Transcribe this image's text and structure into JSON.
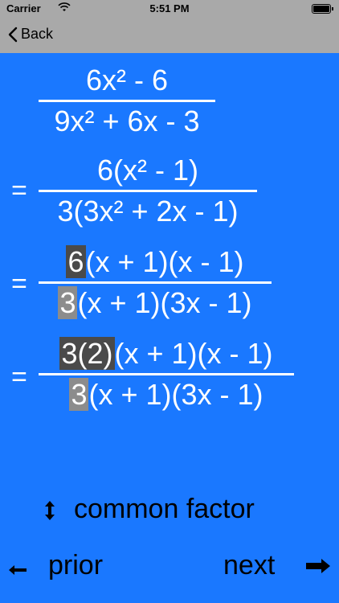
{
  "status": {
    "carrier": "Carrier",
    "time": "5:51 PM"
  },
  "nav": {
    "back_label": "Back"
  },
  "steps": [
    {
      "num": "6x² - 6",
      "den": "9x² + 6x - 3"
    },
    {
      "equals": "=",
      "num": "6(x² - 1)",
      "den": "3(3x² + 2x - 1)"
    },
    {
      "equals": "=",
      "num_hl": "6",
      "num_rest": "(x + 1)(x - 1)",
      "den_hl": "3",
      "den_rest": "(x + 1)(3x - 1)"
    },
    {
      "equals": "=",
      "num_hl": "3(2)",
      "num_rest": "(x + 1)(x - 1)",
      "den_hl": "3",
      "den_rest": "(x + 1)(3x - 1)"
    }
  ],
  "hint": {
    "label": "common factor",
    "icon": "up-down-arrow-icon"
  },
  "controls": {
    "prior_label": "prior",
    "next_label": "next"
  }
}
